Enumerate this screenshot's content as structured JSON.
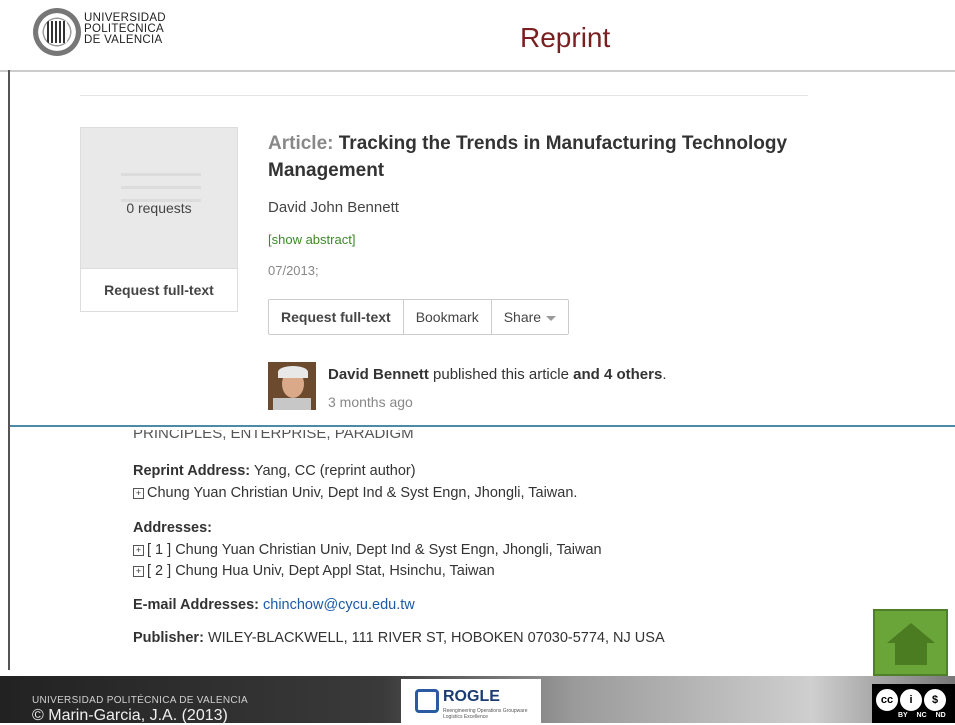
{
  "header": {
    "university_lines": [
      "UNIVERSIDAD",
      "POLITECNICA",
      "DE VALENCIA"
    ],
    "title": "Reprint"
  },
  "article": {
    "thumb_requests": "0 requests",
    "thumb_button": "Request full-text",
    "title_prefix": "Article:",
    "title": "Tracking the Trends in Manufacturing Technology Management",
    "author": "David John Bennett",
    "show_abstract": "[show abstract]",
    "date": "07/2013;",
    "actions": {
      "request": "Request full-text",
      "bookmark": "Bookmark",
      "share": "Share"
    },
    "activity": {
      "name": "David Bennett",
      "middle": "published this article",
      "others": "and 4 others",
      "end": ".",
      "time_ago": "3 months ago"
    }
  },
  "record": {
    "cut_text": "PRINCIPLES, ENTERPRISE, PARADIGM",
    "reprint_label": "Reprint Address:",
    "reprint_value": "Yang, CC (reprint author)",
    "reprint_affil": "Chung Yuan Christian Univ, Dept Ind & Syst Engn, Jhongli, Taiwan.",
    "addresses_label": "Addresses:",
    "address_1": "[ 1 ] Chung Yuan Christian Univ, Dept Ind & Syst Engn, Jhongli, Taiwan",
    "address_2": "[ 2 ] Chung Hua Univ, Dept Appl Stat, Hsinchu, Taiwan",
    "email_label": "E-mail Addresses:",
    "email": "chinchow@cycu.edu.tw",
    "publisher_label": "Publisher:",
    "publisher": "WILEY-BLACKWELL, 111 RIVER ST, HOBOKEN 07030-5774, NJ USA"
  },
  "footer": {
    "university": "UNIVERSIDAD POLITÉCNICA DE VALENCIA",
    "copyright": "© Marin-Garcia, J.A. (2013)",
    "rogle": "ROGLE",
    "rogle_sub": "Reengineering Operations Groupware Logistics Excellence",
    "cc_labels": "BY NC ND"
  },
  "icons": {
    "home": "home-icon",
    "expand": "plus-box-icon",
    "share_caret": "chevron-down-icon",
    "license": "creative-commons-icon"
  },
  "colors": {
    "title": "#7a1f1f",
    "link_green": "#3a8a26",
    "email_blue": "#1a5aa8",
    "home_green": "#6aa53a",
    "divider": "#4d8aa8"
  }
}
